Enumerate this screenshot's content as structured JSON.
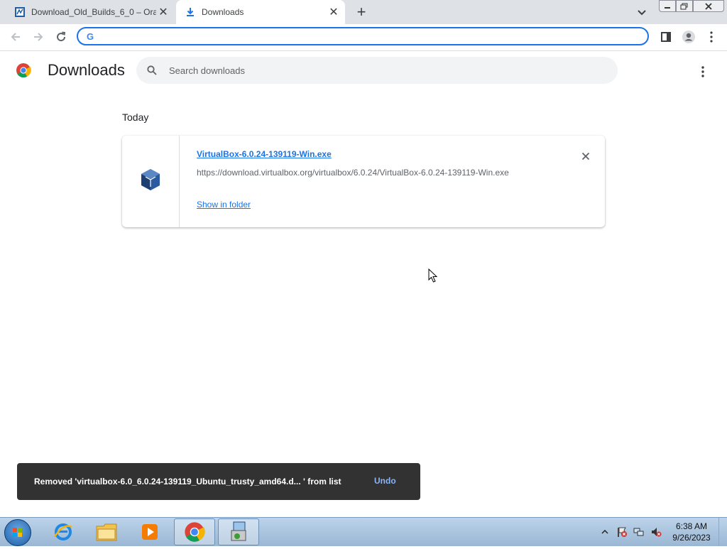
{
  "browser": {
    "tabs": [
      {
        "title": "Download_Old_Builds_6_0 – Orac",
        "favicon": "virtualbox-site-icon",
        "active": false
      },
      {
        "title": "Downloads",
        "favicon": "download-icon",
        "active": true
      }
    ],
    "omnibox": {
      "value": "",
      "placeholder": ""
    }
  },
  "page": {
    "title": "Downloads",
    "search_placeholder": "Search downloads",
    "section_label": "Today",
    "downloads": [
      {
        "filename": "VirtualBox-6.0.24-139119-Win.exe",
        "url": "https://download.virtualbox.org/virtualbox/6.0.24/VirtualBox-6.0.24-139119-Win.exe",
        "action_label": "Show in folder",
        "icon": "virtualbox-icon"
      }
    ]
  },
  "toast": {
    "message": "Removed 'virtualbox-6.0_6.0.24-139119_Ubuntu_trusty_amd64.d... ' from list",
    "action_label": "Undo"
  },
  "taskbar": {
    "items": [
      "start-orb",
      "internet-explorer-icon",
      "file-explorer-icon",
      "media-player-icon",
      "chrome-icon",
      "virtualbox-installer-icon"
    ],
    "clock_time": "6:38 AM",
    "clock_date": "9/26/2023"
  },
  "colors": {
    "accent": "#1a73e8",
    "toast_bg": "#323232",
    "toast_action": "#8ab4f8",
    "tabstrip_bg": "#dee1e6"
  }
}
